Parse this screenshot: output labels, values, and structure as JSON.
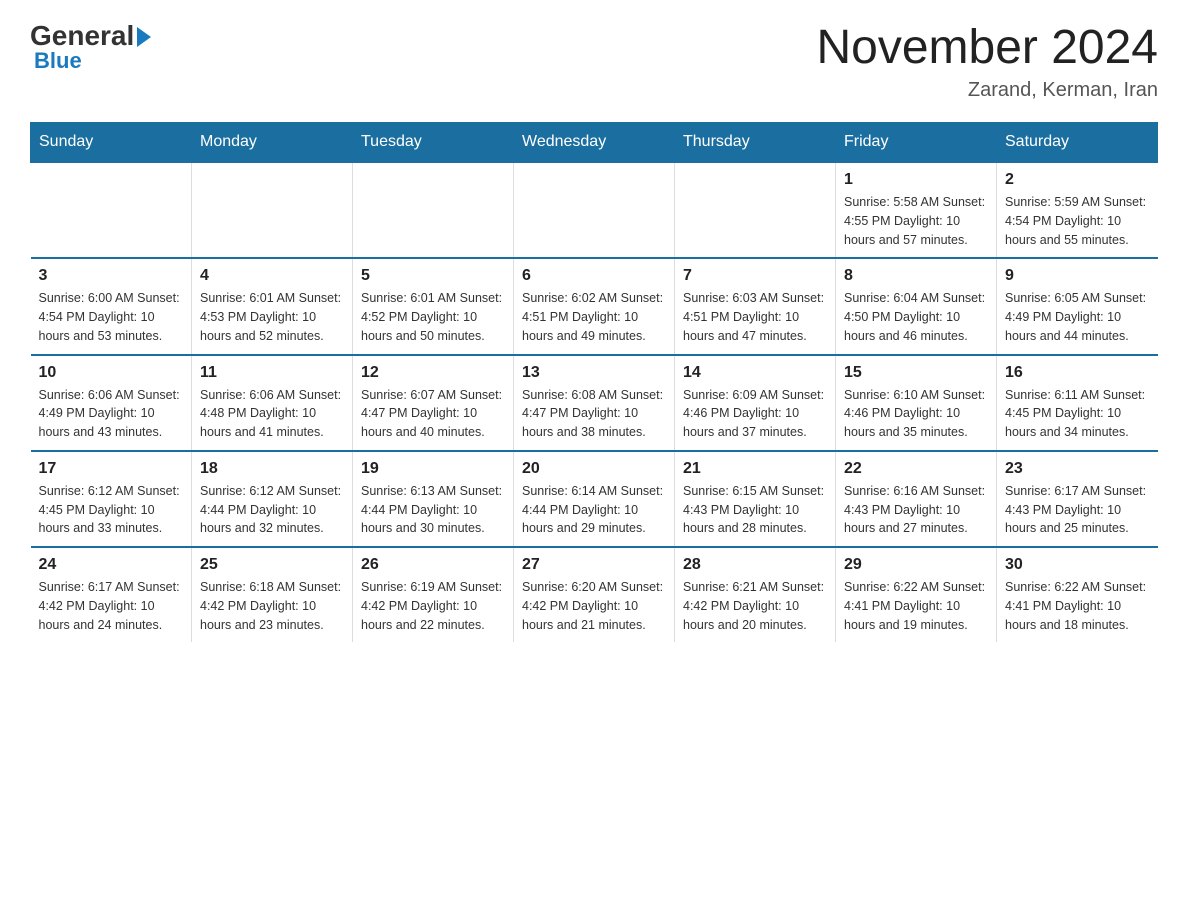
{
  "header": {
    "logo_general": "General",
    "logo_blue": "Blue",
    "month_title": "November 2024",
    "location": "Zarand, Kerman, Iran"
  },
  "days_of_week": [
    "Sunday",
    "Monday",
    "Tuesday",
    "Wednesday",
    "Thursday",
    "Friday",
    "Saturday"
  ],
  "weeks": [
    [
      {
        "day": "",
        "info": ""
      },
      {
        "day": "",
        "info": ""
      },
      {
        "day": "",
        "info": ""
      },
      {
        "day": "",
        "info": ""
      },
      {
        "day": "",
        "info": ""
      },
      {
        "day": "1",
        "info": "Sunrise: 5:58 AM\nSunset: 4:55 PM\nDaylight: 10 hours and 57 minutes."
      },
      {
        "day": "2",
        "info": "Sunrise: 5:59 AM\nSunset: 4:54 PM\nDaylight: 10 hours and 55 minutes."
      }
    ],
    [
      {
        "day": "3",
        "info": "Sunrise: 6:00 AM\nSunset: 4:54 PM\nDaylight: 10 hours and 53 minutes."
      },
      {
        "day": "4",
        "info": "Sunrise: 6:01 AM\nSunset: 4:53 PM\nDaylight: 10 hours and 52 minutes."
      },
      {
        "day": "5",
        "info": "Sunrise: 6:01 AM\nSunset: 4:52 PM\nDaylight: 10 hours and 50 minutes."
      },
      {
        "day": "6",
        "info": "Sunrise: 6:02 AM\nSunset: 4:51 PM\nDaylight: 10 hours and 49 minutes."
      },
      {
        "day": "7",
        "info": "Sunrise: 6:03 AM\nSunset: 4:51 PM\nDaylight: 10 hours and 47 minutes."
      },
      {
        "day": "8",
        "info": "Sunrise: 6:04 AM\nSunset: 4:50 PM\nDaylight: 10 hours and 46 minutes."
      },
      {
        "day": "9",
        "info": "Sunrise: 6:05 AM\nSunset: 4:49 PM\nDaylight: 10 hours and 44 minutes."
      }
    ],
    [
      {
        "day": "10",
        "info": "Sunrise: 6:06 AM\nSunset: 4:49 PM\nDaylight: 10 hours and 43 minutes."
      },
      {
        "day": "11",
        "info": "Sunrise: 6:06 AM\nSunset: 4:48 PM\nDaylight: 10 hours and 41 minutes."
      },
      {
        "day": "12",
        "info": "Sunrise: 6:07 AM\nSunset: 4:47 PM\nDaylight: 10 hours and 40 minutes."
      },
      {
        "day": "13",
        "info": "Sunrise: 6:08 AM\nSunset: 4:47 PM\nDaylight: 10 hours and 38 minutes."
      },
      {
        "day": "14",
        "info": "Sunrise: 6:09 AM\nSunset: 4:46 PM\nDaylight: 10 hours and 37 minutes."
      },
      {
        "day": "15",
        "info": "Sunrise: 6:10 AM\nSunset: 4:46 PM\nDaylight: 10 hours and 35 minutes."
      },
      {
        "day": "16",
        "info": "Sunrise: 6:11 AM\nSunset: 4:45 PM\nDaylight: 10 hours and 34 minutes."
      }
    ],
    [
      {
        "day": "17",
        "info": "Sunrise: 6:12 AM\nSunset: 4:45 PM\nDaylight: 10 hours and 33 minutes."
      },
      {
        "day": "18",
        "info": "Sunrise: 6:12 AM\nSunset: 4:44 PM\nDaylight: 10 hours and 32 minutes."
      },
      {
        "day": "19",
        "info": "Sunrise: 6:13 AM\nSunset: 4:44 PM\nDaylight: 10 hours and 30 minutes."
      },
      {
        "day": "20",
        "info": "Sunrise: 6:14 AM\nSunset: 4:44 PM\nDaylight: 10 hours and 29 minutes."
      },
      {
        "day": "21",
        "info": "Sunrise: 6:15 AM\nSunset: 4:43 PM\nDaylight: 10 hours and 28 minutes."
      },
      {
        "day": "22",
        "info": "Sunrise: 6:16 AM\nSunset: 4:43 PM\nDaylight: 10 hours and 27 minutes."
      },
      {
        "day": "23",
        "info": "Sunrise: 6:17 AM\nSunset: 4:43 PM\nDaylight: 10 hours and 25 minutes."
      }
    ],
    [
      {
        "day": "24",
        "info": "Sunrise: 6:17 AM\nSunset: 4:42 PM\nDaylight: 10 hours and 24 minutes."
      },
      {
        "day": "25",
        "info": "Sunrise: 6:18 AM\nSunset: 4:42 PM\nDaylight: 10 hours and 23 minutes."
      },
      {
        "day": "26",
        "info": "Sunrise: 6:19 AM\nSunset: 4:42 PM\nDaylight: 10 hours and 22 minutes."
      },
      {
        "day": "27",
        "info": "Sunrise: 6:20 AM\nSunset: 4:42 PM\nDaylight: 10 hours and 21 minutes."
      },
      {
        "day": "28",
        "info": "Sunrise: 6:21 AM\nSunset: 4:42 PM\nDaylight: 10 hours and 20 minutes."
      },
      {
        "day": "29",
        "info": "Sunrise: 6:22 AM\nSunset: 4:41 PM\nDaylight: 10 hours and 19 minutes."
      },
      {
        "day": "30",
        "info": "Sunrise: 6:22 AM\nSunset: 4:41 PM\nDaylight: 10 hours and 18 minutes."
      }
    ]
  ]
}
